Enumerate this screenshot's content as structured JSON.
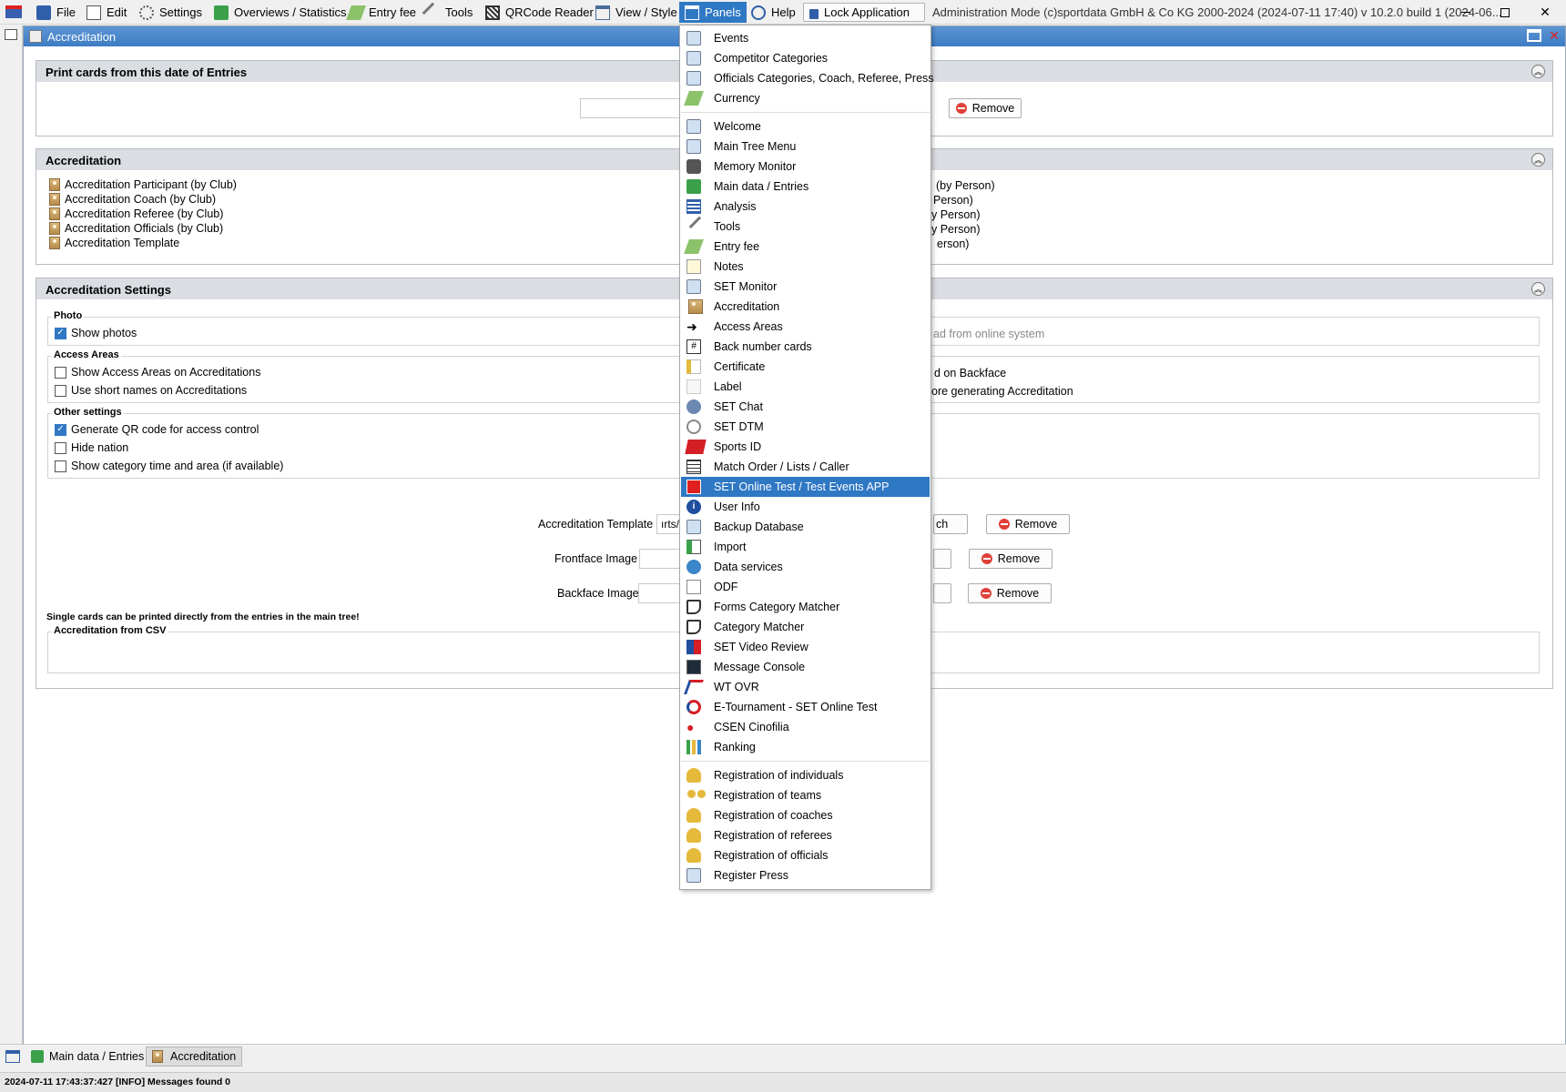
{
  "menubar": {
    "items": [
      "File",
      "Edit",
      "Settings",
      "Overviews / Statistics",
      "Entry fee",
      "Tools",
      "QRCode Reader",
      "View / Style",
      "Panels",
      "Help"
    ],
    "lock_label": "Lock Application",
    "info": "Administration Mode (c)sportdata GmbH & Co KG 2000-2024 (2024-07-11 17:40)  v 10.2.0 build 1 (2024-06..."
  },
  "window": {
    "title": "Accreditation"
  },
  "print_section": {
    "title": "Print cards from this date of Entries",
    "remove_label": "Remove"
  },
  "accreditation_section": {
    "title": "Accreditation",
    "left_items": [
      "Accreditation Participant (by Club)",
      "Accreditation Coach (by Club)",
      "Accreditation Referee (by Club)",
      "Accreditation Officials (by Club)",
      "Accreditation Template"
    ],
    "right_items": [
      "(by Person)",
      "Person)",
      "y Person)",
      "y Person)",
      "erson)"
    ]
  },
  "settings_section": {
    "title": "Accreditation Settings",
    "photo": {
      "legend": "Photo",
      "show_photos": "Show photos",
      "right_text": "ad from online system"
    },
    "access_areas": {
      "legend": "Access Areas",
      "show_areas": "Show Access Areas on Accreditations",
      "short_names": "Use short names on Accreditations",
      "right_text1": "d on Backface",
      "right_text2": "ore generating Accreditation"
    },
    "other": {
      "legend": "Other settings",
      "qr": "Generate QR code for access control",
      "hide_nation": "Hide nation",
      "show_category": "Show category time and area (if available)"
    },
    "template_label": "Accreditation Template",
    "template_value": "ırts/",
    "template_search": "ch",
    "frontface_label": "Frontface Image",
    "backface_label": "Backface Image",
    "remove_label": "Remove",
    "note": "Single cards can be printed directly from the entries in the main tree!",
    "csv_legend": "Accreditation from CSV"
  },
  "tabs": [
    "Main data / Entries",
    "Accreditation"
  ],
  "status": "2024-07-11 17:43:37:427 [INFO] Messages found 0",
  "panels_menu": {
    "group1": [
      "Events",
      "Competitor Categories",
      "Officials Categories, Coach, Referee, Press",
      "Currency"
    ],
    "group2": [
      "Welcome",
      "Main Tree Menu",
      "Memory Monitor",
      "Main data / Entries",
      "Analysis",
      "Tools",
      "Entry fee",
      "Notes",
      "SET Monitor",
      "Accreditation",
      "Access Areas",
      "Back number cards",
      "Certificate",
      "Label",
      "SET Chat",
      "SET DTM",
      "Sports ID",
      "Match Order / Lists / Caller",
      "SET Online Test / Test Events APP",
      "User Info",
      "Backup Database",
      "Import",
      "Data services",
      "ODF",
      "Forms Category Matcher",
      "Category Matcher",
      "SET Video Review",
      "Message Console",
      "WT OVR",
      "E-Tournament - SET Online Test",
      "CSEN Cinofilia",
      "Ranking"
    ],
    "group3": [
      "Registration of individuals",
      "Registration of teams",
      "Registration of coaches",
      "Registration of referees",
      "Registration of officials",
      "Register Press"
    ],
    "highlighted": "SET Online Test / Test Events APP"
  },
  "colors": {
    "accent": "#2f78c4",
    "titlebar": "#3d7cc4",
    "remove": "#e0403a"
  }
}
